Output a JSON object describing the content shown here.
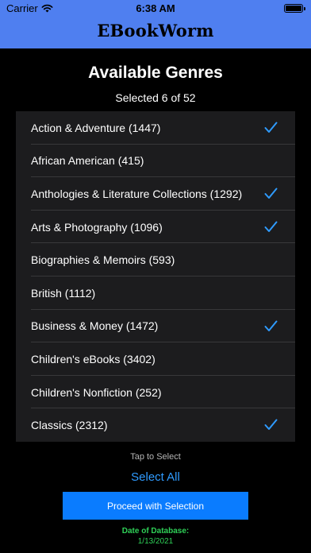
{
  "status_bar": {
    "carrier": "Carrier",
    "time": "6:38 AM"
  },
  "header": {
    "app_title": "EBookWorm"
  },
  "page": {
    "title": "Available Genres",
    "selection_count": "Selected 6 of 52"
  },
  "genres": [
    {
      "label": "Action & Adventure (1447)",
      "selected": true
    },
    {
      "label": "African American (415)",
      "selected": false
    },
    {
      "label": "Anthologies & Literature Collections (1292)",
      "selected": true
    },
    {
      "label": "Arts & Photography (1096)",
      "selected": true
    },
    {
      "label": "Biographies & Memoirs (593)",
      "selected": false
    },
    {
      "label": "British (1112)",
      "selected": false
    },
    {
      "label": "Business & Money (1472)",
      "selected": true
    },
    {
      "label": "Children's eBooks (3402)",
      "selected": false
    },
    {
      "label": "Children's Nonfiction (252)",
      "selected": false
    },
    {
      "label": "Classics (2312)",
      "selected": true
    }
  ],
  "footer": {
    "hint": "Tap to Select",
    "select_all_label": "Select All",
    "proceed_label": "Proceed with Selection",
    "db_date_label": "Date of Database:",
    "db_date_value": "1/13/2021"
  },
  "colors": {
    "header_bg": "#4f7ff0",
    "accent": "#0a7cff",
    "checkmark": "#2f9bff",
    "date_text": "#2fd158",
    "list_bg": "#1c1c1e"
  },
  "icons": {
    "status": [
      "wifi-icon",
      "battery-icon"
    ],
    "row_selected": "checkmark-icon"
  }
}
